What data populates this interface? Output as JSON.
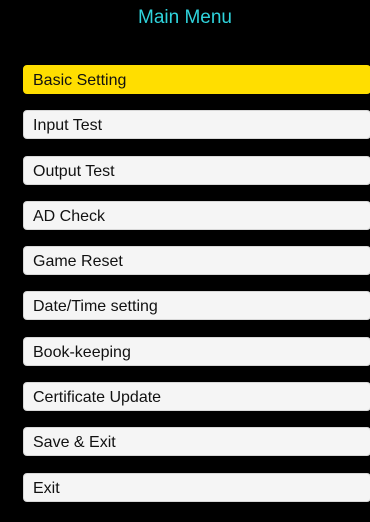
{
  "title": "Main Menu",
  "selected_index": 0,
  "colors": {
    "background": "#000000",
    "title": "#2fd3dc",
    "item_background": "#f5f5f5",
    "selected_background": "#ffde00",
    "item_text": "#111111"
  },
  "menu": {
    "items": [
      {
        "label": "Basic Setting"
      },
      {
        "label": "Input Test"
      },
      {
        "label": "Output Test"
      },
      {
        "label": "AD Check"
      },
      {
        "label": "Game Reset"
      },
      {
        "label": "Date/Time setting"
      },
      {
        "label": "Book-keeping"
      },
      {
        "label": "Certificate Update"
      },
      {
        "label": "Save & Exit"
      },
      {
        "label": "Exit"
      }
    ]
  }
}
